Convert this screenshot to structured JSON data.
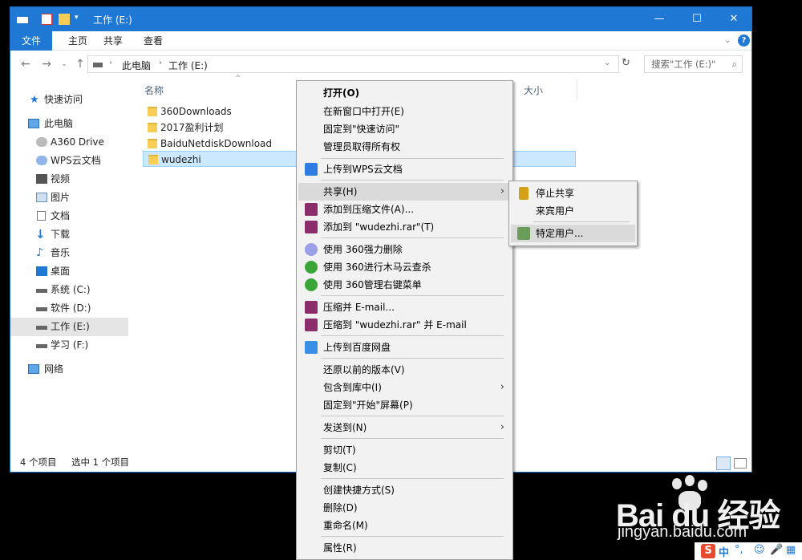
{
  "window": {
    "title": "工作 (E:)",
    "controls": {
      "minimize": "—",
      "maximize": "☐",
      "close": "✕"
    }
  },
  "ribbon": {
    "tabs": [
      "文件",
      "主页",
      "共享",
      "查看"
    ]
  },
  "address": {
    "crumbs": [
      "此电脑",
      "工作 (E:)"
    ],
    "search_placeholder": "搜索\"工作 (E:)\""
  },
  "sidebar": {
    "items": [
      {
        "label": "快速访问",
        "icon": "star-icon"
      },
      {
        "label": "此电脑",
        "icon": "computer-icon"
      },
      {
        "label": "A360 Drive",
        "icon": "cloud-icon"
      },
      {
        "label": "WPS云文档",
        "icon": "cloud-icon"
      },
      {
        "label": "视频",
        "icon": "video-icon"
      },
      {
        "label": "图片",
        "icon": "picture-icon"
      },
      {
        "label": "文档",
        "icon": "document-icon"
      },
      {
        "label": "下载",
        "icon": "download-icon"
      },
      {
        "label": "音乐",
        "icon": "music-icon"
      },
      {
        "label": "桌面",
        "icon": "desktop-icon"
      },
      {
        "label": "系统 (C:)",
        "icon": "drive-icon"
      },
      {
        "label": "软件 (D:)",
        "icon": "drive-icon"
      },
      {
        "label": "工作 (E:)",
        "icon": "drive-icon"
      },
      {
        "label": "学习 (F:)",
        "icon": "drive-icon"
      },
      {
        "label": "网络",
        "icon": "network-icon"
      }
    ]
  },
  "files": {
    "columns": {
      "name": "名称",
      "size": "大小"
    },
    "rows": [
      "360Downloads",
      "2017盈利计划",
      "BaiduNetdiskDownload",
      "wudezhi"
    ]
  },
  "status": {
    "count": "4 个项目",
    "selected": "选中 1 个项目"
  },
  "context_menu": {
    "items": [
      {
        "label": "打开(O)",
        "bold": true
      },
      {
        "label": "在新窗口中打开(E)"
      },
      {
        "label": "固定到\"快速访问\""
      },
      {
        "label": "管理员取得所有权"
      },
      {
        "label": "上传到WPS云文档",
        "icon": "wps-cloud-icon"
      },
      {
        "label": "共享(H)",
        "submenu": true
      },
      {
        "label": "添加到压缩文件(A)...",
        "icon": "winrar-icon"
      },
      {
        "label": "添加到 \"wudezhi.rar\"(T)",
        "icon": "winrar-icon"
      },
      {
        "label": "使用 360强力删除",
        "icon": "360-delete-icon"
      },
      {
        "label": "使用 360进行木马云查杀",
        "icon": "360-scan-icon"
      },
      {
        "label": "使用 360管理右键菜单",
        "icon": "360-menu-icon"
      },
      {
        "label": "压缩并 E-mail...",
        "icon": "winrar-icon"
      },
      {
        "label": "压缩到 \"wudezhi.rar\" 并 E-mail",
        "icon": "winrar-icon"
      },
      {
        "label": "上传到百度网盘",
        "icon": "baidu-netdisk-icon"
      },
      {
        "label": "还原以前的版本(V)"
      },
      {
        "label": "包含到库中(I)",
        "submenu": true
      },
      {
        "label": "固定到\"开始\"屏幕(P)"
      },
      {
        "label": "发送到(N)",
        "submenu": true
      },
      {
        "label": "剪切(T)"
      },
      {
        "label": "复制(C)"
      },
      {
        "label": "创建快捷方式(S)"
      },
      {
        "label": "删除(D)"
      },
      {
        "label": "重命名(M)"
      },
      {
        "label": "属性(R)"
      }
    ]
  },
  "share_submenu": {
    "items": [
      {
        "label": "停止共享",
        "icon": "lock-icon"
      },
      {
        "label": "来宾用户"
      },
      {
        "label": "特定用户...",
        "icon": "users-icon"
      }
    ]
  },
  "watermark": {
    "brand": "Bai du 经验",
    "url": "jingyan.baidu.com"
  },
  "tray": {
    "ime": "中",
    "symbols": "°,"
  },
  "colors": {
    "titlebar": "#1e78d4",
    "selection": "#cce8ff",
    "menu_bg": "#f2f2f2"
  }
}
